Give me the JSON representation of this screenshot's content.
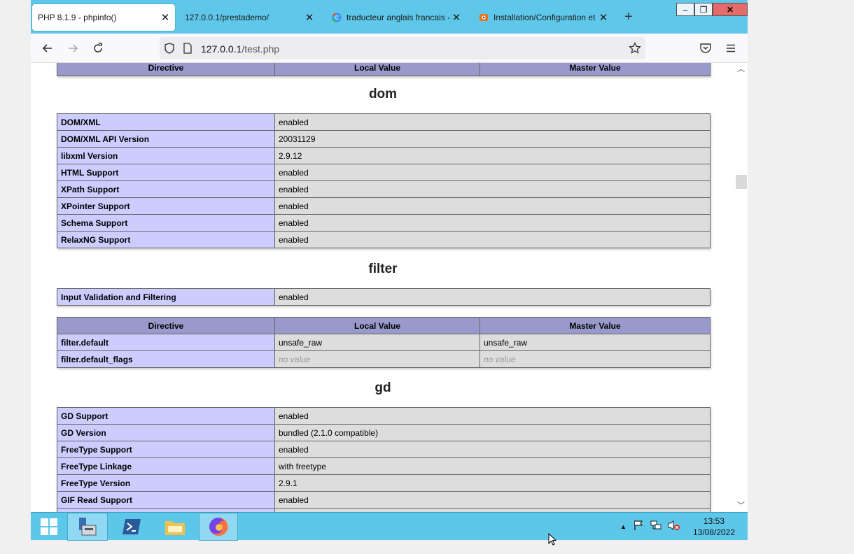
{
  "browser": {
    "tabs": [
      {
        "title": "PHP 8.1.9 - phpinfo()",
        "active": true
      },
      {
        "title": "127.0.0.1/prestademo/",
        "active": false
      },
      {
        "title": "traducteur anglais francais - G",
        "active": false
      },
      {
        "title": "Installation/Configuration et",
        "active": false
      }
    ],
    "new_tab_label": "+",
    "url_host": "127.0.0.1",
    "url_path": "/test.php",
    "minimize_label": "–",
    "restore_label": "❐",
    "close_label": "✕"
  },
  "page": {
    "top_header": {
      "directive": "Directive",
      "local": "Local Value",
      "master": "Master Value"
    },
    "dom": {
      "title": "dom",
      "rows": [
        {
          "k": "DOM/XML",
          "v": "enabled"
        },
        {
          "k": "DOM/XML API Version",
          "v": "20031129"
        },
        {
          "k": "libxml Version",
          "v": "2.9.12"
        },
        {
          "k": "HTML Support",
          "v": "enabled"
        },
        {
          "k": "XPath Support",
          "v": "enabled"
        },
        {
          "k": "XPointer Support",
          "v": "enabled"
        },
        {
          "k": "Schema Support",
          "v": "enabled"
        },
        {
          "k": "RelaxNG Support",
          "v": "enabled"
        }
      ]
    },
    "filter": {
      "title": "filter",
      "info_row": {
        "k": "Input Validation and Filtering",
        "v": "enabled"
      },
      "header": {
        "directive": "Directive",
        "local": "Local Value",
        "master": "Master Value"
      },
      "rows": [
        {
          "k": "filter.default",
          "local": "unsafe_raw",
          "master": "unsafe_raw"
        },
        {
          "k": "filter.default_flags",
          "local": "no value",
          "master": "no value"
        }
      ]
    },
    "gd": {
      "title": "gd",
      "rows": [
        {
          "k": "GD Support",
          "v": "enabled"
        },
        {
          "k": "GD Version",
          "v": "bundled (2.1.0 compatible)"
        },
        {
          "k": "FreeType Support",
          "v": "enabled"
        },
        {
          "k": "FreeType Linkage",
          "v": "with freetype"
        },
        {
          "k": "FreeType Version",
          "v": "2.9.1"
        },
        {
          "k": "GIF Read Support",
          "v": "enabled"
        }
      ]
    }
  },
  "taskbar": {
    "time": "13:53",
    "date": "13/08/2022"
  },
  "colors": {
    "tabbar": "#5fc8ea",
    "key_cell": "#ccccff",
    "value_cell": "#dddddd",
    "header_cell": "#9999cc",
    "taskbar": "#5dc7ea"
  }
}
